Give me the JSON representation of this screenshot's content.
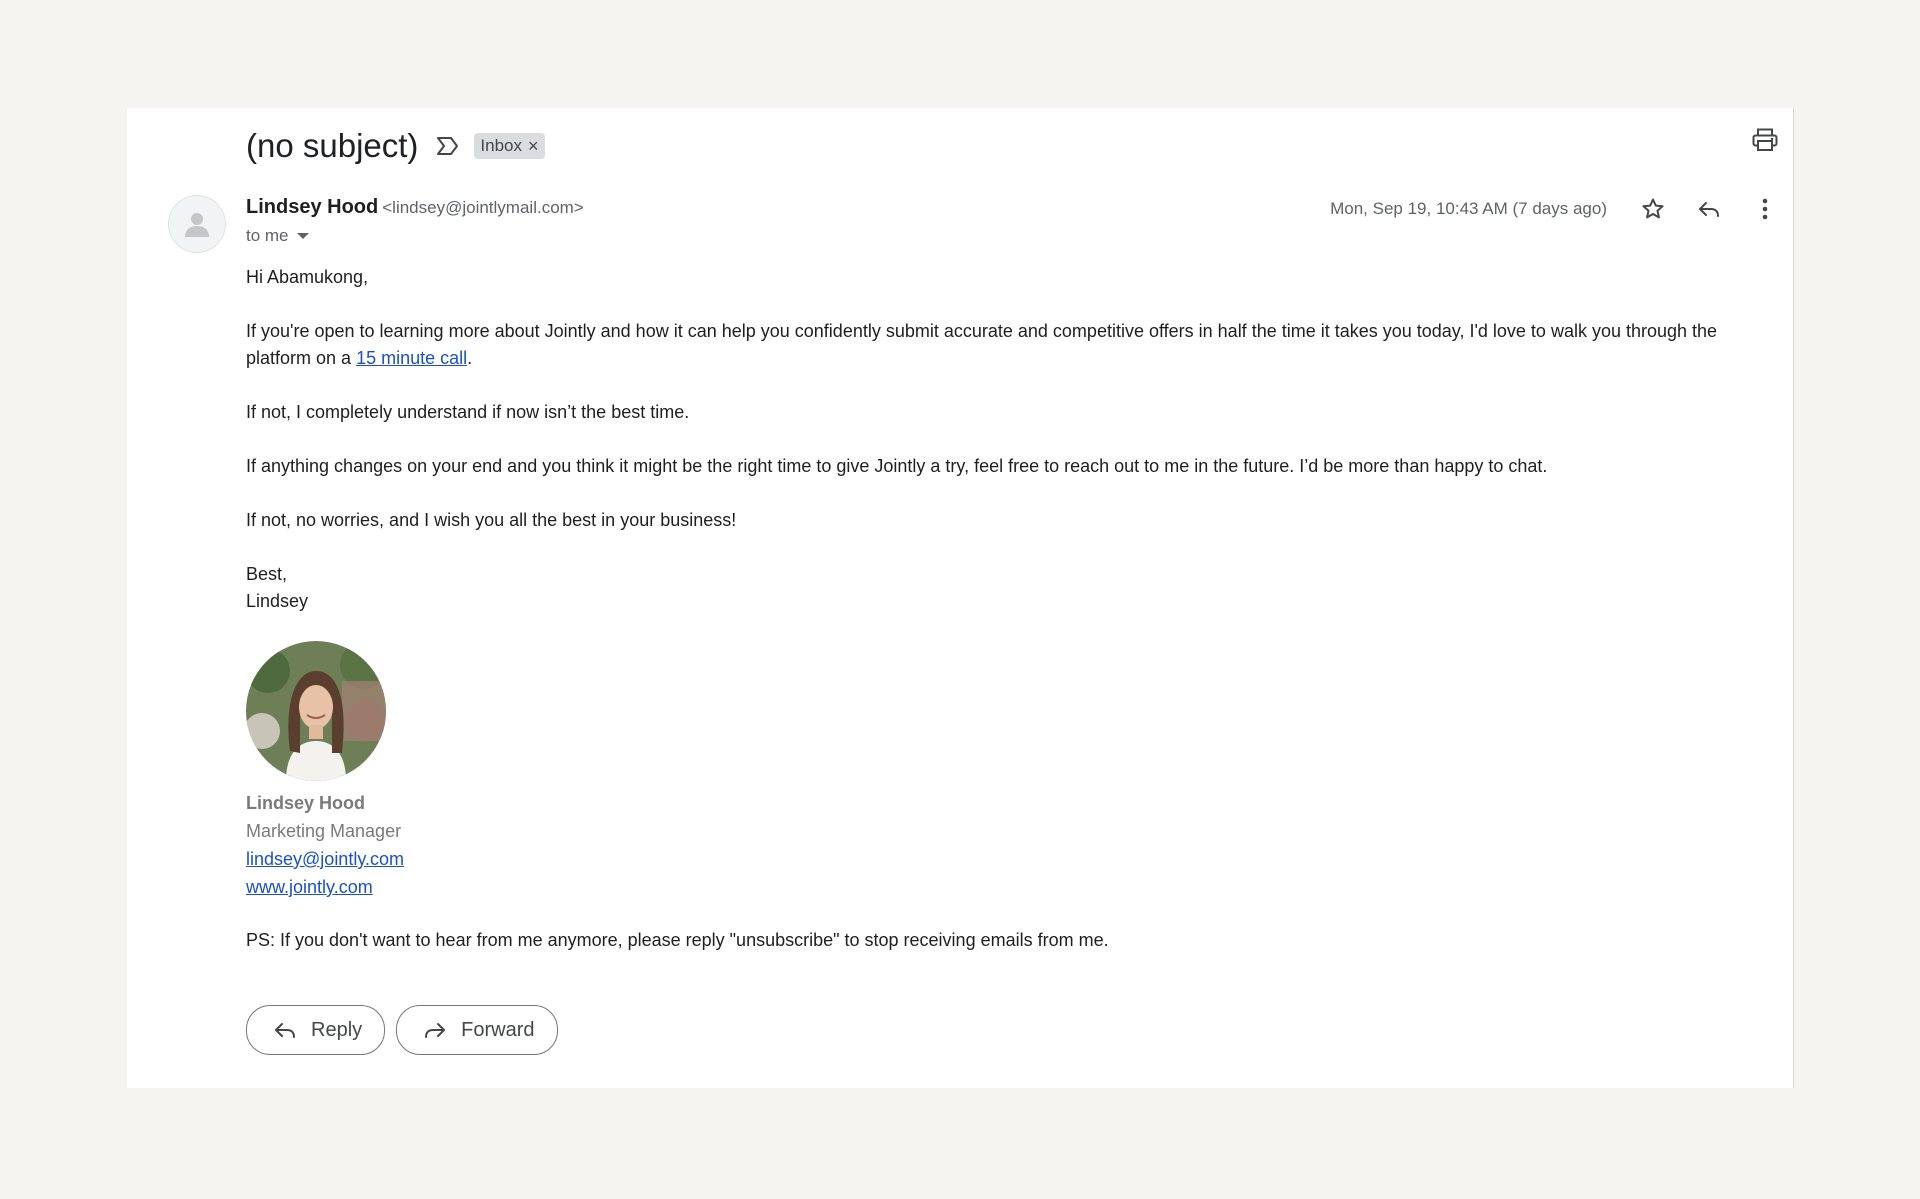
{
  "email": {
    "subject": "(no subject)",
    "label": "Inbox",
    "label_remove": "×",
    "sender_name": "Lindsey Hood",
    "sender_email": "<lindsey@jointlymail.com>",
    "recipient": "to me",
    "date": "Mon, Sep 19, 10:43 AM (7 days ago)"
  },
  "body": {
    "greeting": "Hi Abamukong,",
    "p1_before": "If you're open to learning more about Jointly and how it can help you confidently submit accurate and competitive offers in half the time it takes you today, I'd love to walk you through the platform on a ",
    "p1_link": "15 minute call",
    "p1_after": ".",
    "p2": "If not, I completely understand if now isn’t the best time.",
    "p3": "If anything changes on your end and you think it might be the right time to give Jointly a try, feel free to reach out to me in the future. I’d be more than happy to chat.",
    "p4": "If not, no worries, and I wish you all the best in your business!",
    "closing": "Best,",
    "closing_name": "Lindsey",
    "ps": "PS: If you don't want to hear from me anymore, please reply \"unsubscribe\" to stop receiving emails from me."
  },
  "signature": {
    "name": "Lindsey Hood",
    "title": "Marketing Manager",
    "email": "lindsey@jointly.com",
    "website": "www.jointly.com"
  },
  "actions": {
    "reply_label": "Reply",
    "forward_label": "Forward"
  },
  "icons": {
    "important": "label-important-outline-icon",
    "print": "print-icon",
    "star": "star-outline-icon",
    "reply": "reply-icon",
    "more": "more-vert-icon",
    "forward": "forward-icon",
    "avatar": "person-icon"
  },
  "colors": {
    "link": "#1a4fd0",
    "page_background": "#f5f4f1",
    "chip": "#dadce0"
  }
}
